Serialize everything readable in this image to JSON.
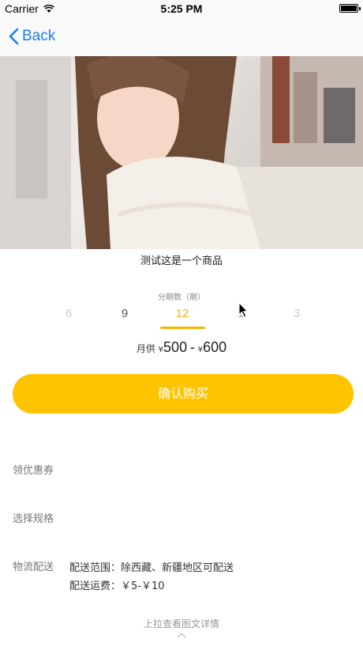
{
  "status_bar": {
    "carrier": "Carrier",
    "time": "5:25 PM"
  },
  "nav": {
    "back_label": "Back"
  },
  "product": {
    "title": "测试这是一个商品"
  },
  "installment": {
    "label": "分期数（期）",
    "options": [
      "6",
      "9",
      "12",
      "1",
      "3"
    ],
    "selected": "12"
  },
  "price": {
    "prefix": "月供",
    "currency": "¥",
    "min": "500",
    "separator": "-",
    "max": "600"
  },
  "confirm_button": {
    "label": "确认购买"
  },
  "rows": {
    "coupon_label": "领优惠券",
    "spec_label": "选择规格",
    "logistics_label": "物流配送",
    "logistics_range": "配送范围：除西藏、新疆地区可配送",
    "logistics_fee": "配送运费：￥5-￥10"
  },
  "footer": {
    "pull_hint": "上拉查看图文详情"
  },
  "colors": {
    "accent": "#ffc400",
    "link": "#1a7ef5"
  }
}
